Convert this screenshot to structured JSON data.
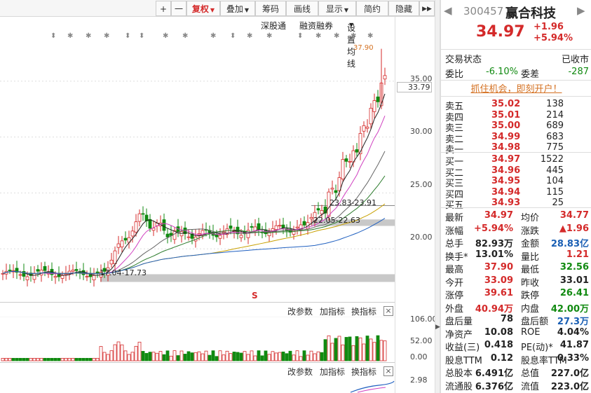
{
  "toolbar": {
    "plus": "+",
    "minus": "一",
    "buttons": [
      "复权",
      "叠加",
      "筹码",
      "画线",
      "显示",
      "简约",
      "隐藏"
    ],
    "more": "▶▶"
  },
  "subbar": {
    "items": [
      "深股通",
      "融资融券",
      "设置均线"
    ]
  },
  "chart": {
    "high_label": "37.90",
    "current_tag": "33.79",
    "y_labels": [
      "35.00",
      "30.00",
      "25.00",
      "20.00"
    ],
    "range_labels": [
      "23.83-23.91",
      "22.05-22.63",
      "17.04-17.73"
    ],
    "marker": "S"
  },
  "volume_panel": {
    "buttons": [
      "改参数",
      "加指标",
      "换指标"
    ],
    "close": "×",
    "y_labels": [
      "106.00",
      "52.00",
      "0.00"
    ]
  },
  "indicator_panel": {
    "buttons": [
      "改参数",
      "加指标",
      "换指标"
    ],
    "close": "×",
    "y_labels": [
      "2.98"
    ]
  },
  "quote": {
    "code": "300457",
    "name": "赢合科技",
    "price": "34.97",
    "change": "+1.96",
    "change_pct": "+5.94%",
    "status_label": "交易状态",
    "status": "已收市",
    "weibi_label": "委比",
    "weibi": "-6.10%",
    "weicha_label": "委差",
    "weicha": "-287",
    "promo": "抓住机会，即刻开户！",
    "asks": [
      {
        "label": "卖五",
        "price": "35.02",
        "vol": "138"
      },
      {
        "label": "卖四",
        "price": "35.01",
        "vol": "214"
      },
      {
        "label": "卖三",
        "price": "35.00",
        "vol": "689"
      },
      {
        "label": "卖二",
        "price": "34.99",
        "vol": "683"
      },
      {
        "label": "卖一",
        "price": "34.98",
        "vol": "775"
      }
    ],
    "bids": [
      {
        "label": "买一",
        "price": "34.97",
        "vol": "1522"
      },
      {
        "label": "买二",
        "price": "34.96",
        "vol": "445"
      },
      {
        "label": "买三",
        "price": "34.95",
        "vol": "104"
      },
      {
        "label": "买四",
        "price": "34.94",
        "vol": "115"
      },
      {
        "label": "买五",
        "price": "34.93",
        "vol": "25"
      }
    ],
    "stats": [
      {
        "l1": "最新",
        "v1": "34.97",
        "c1": "red",
        "l2": "均价",
        "v2": "34.77",
        "c2": "red"
      },
      {
        "l1": "涨幅",
        "v1": "+5.94%",
        "c1": "red",
        "l2": "涨跌",
        "v2": "▲1.96",
        "c2": "red"
      },
      {
        "l1": "总手",
        "v1": "82.93万",
        "c1": "",
        "l2": "金额",
        "v2": "28.83亿",
        "c2": "blue"
      },
      {
        "l1": "换手*",
        "v1": "13.01%",
        "c1": "",
        "l2": "量比",
        "v2": "1.21",
        "c2": "red"
      },
      {
        "l1": "最高",
        "v1": "37.90",
        "c1": "red",
        "l2": "最低",
        "v2": "32.56",
        "c2": "green"
      },
      {
        "l1": "今开",
        "v1": "33.09",
        "c1": "red",
        "l2": "昨收",
        "v2": "33.01",
        "c2": ""
      },
      {
        "l1": "涨停",
        "v1": "39.61",
        "c1": "red",
        "l2": "跌停",
        "v2": "26.41",
        "c2": "green"
      },
      {
        "l1": "外盘",
        "v1": "40.94万",
        "c1": "red",
        "l2": "内盘",
        "v2": "42.00万",
        "c2": "green"
      },
      {
        "l1": "盘后量",
        "v1": "78",
        "c1": "",
        "l2": "盘后额",
        "v2": "27.3万",
        "c2": "blue"
      },
      {
        "l1": "净资产",
        "v1": "10.08",
        "c1": "",
        "l2": "ROE",
        "v2": "4.04%",
        "c2": ""
      },
      {
        "l1": "收益(三)",
        "v1": "0.418",
        "c1": "",
        "l2": "PE(动)*",
        "v2": "41.87",
        "c2": ""
      },
      {
        "l1": "股息TTM",
        "v1": "0.12",
        "c1": "",
        "l2": "股息率TTM",
        "v2": "0.33%",
        "c2": ""
      },
      {
        "l1": "总股本",
        "v1": "6.491亿",
        "c1": "",
        "l2": "总值",
        "v2": "227.0亿",
        "c2": ""
      },
      {
        "l1": "流通股",
        "v1": "6.376亿",
        "c1": "",
        "l2": "流值",
        "v2": "223.0亿",
        "c2": ""
      }
    ]
  },
  "colors": {
    "up": "#d42a2a",
    "down": "#118a11",
    "ma_pink": "#d040c0",
    "ma_dark": "#222222",
    "ma_green": "#2a7a2a",
    "ma_blue": "#2060c0",
    "ma_gold": "#c8a000",
    "band": "#c8c8c8"
  }
}
